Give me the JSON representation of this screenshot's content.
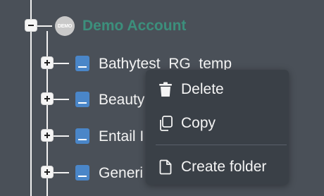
{
  "account": {
    "avatar_text": "DEMO",
    "name": "Demo Account",
    "name_color": "#3c8f7c"
  },
  "tree": {
    "items": [
      {
        "label": "Bathytest_RG_temp",
        "icon": "book-icon"
      },
      {
        "label": "Beauty",
        "icon": "book-icon"
      },
      {
        "label": "Entail I",
        "icon": "book-icon"
      },
      {
        "label": "Generi",
        "icon": "book-icon"
      }
    ]
  },
  "context_menu": {
    "items": [
      {
        "label": "Delete",
        "icon": "trash-icon"
      },
      {
        "label": "Copy",
        "icon": "copy-icon"
      },
      {
        "label": "Create folder",
        "icon": "file-icon"
      }
    ]
  },
  "colors": {
    "background": "#4a5058",
    "menu_background": "#3a4047",
    "book_icon": "#4a86c8"
  }
}
